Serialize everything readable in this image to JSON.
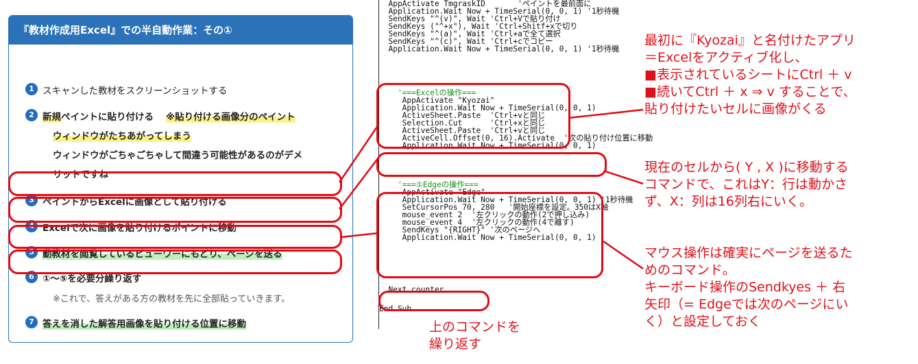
{
  "panel": {
    "title": "『教材作成用Excel』での半自動作業：その①",
    "steps": [
      {
        "num": "1",
        "text": "スキャンした教材をスクリーンショットする"
      },
      {
        "num": "2",
        "text_a": "新規",
        "text_b": "ペイントに貼り付ける",
        "text_c": "※貼り付ける画像分のペイント",
        "text_d": "ウィンドウがたちあがってしまう",
        "warn_1": "ウィンドウがごちゃごちゃして間違う可能性があるのがデメ",
        "warn_2": "リットですね"
      },
      {
        "num": "3",
        "text": "ペイントからExcelに画像として貼り付ける"
      },
      {
        "num": "4",
        "text": "Excelで次に画像を貼り付けるポイントに移動"
      },
      {
        "num": "5",
        "text": "動教材を閲覧しているビューワーにもどり、ページを送る"
      },
      {
        "num": "6",
        "text": "①～⑤を必要分繰り返す",
        "note": "※これで、答えがある方の教材を先に全部貼っていきます。"
      },
      {
        "num": "7",
        "text": "答えを消した解答用画像を貼り付ける位置に移動"
      }
    ]
  },
  "code_lines": [
    "  AppActivate TmgraskID       'ペイントを最前面に",
    "  Application.Wait Now + TimeSerial(0, 0, 1) '1秒待機",
    "  SendKeys \"^(v)\", Wait 'Ctrl+Vで貼り付け",
    "  SendKeys (\"^+x\"), Wait 'Ctrl+Shitf+xで切り",
    "  SendKeys \"^(a)\", Wait 'Ctrl+aで全て選択",
    "  SendKeys \"^(c)\", Wait 'Ctrl+cでコピー",
    "  Application.Wait Now + TimeSerial(0, 0, 1) '1秒待機",
    "",
    "    '===Excelの操作===",
    "     AppActivate \"Kyozai\"",
    "     Application.Wait Now + TimeSerial(0, 0, 1)",
    "     ActiveSheet.Paste  'Ctrl+vと同じ",
    "     Selection.Cut      'Ctrl+xと同じ",
    "     ActiveSheet.Paste  'Ctrl+vと同じ",
    "     ActiveCell.Offset(0, 16).Activate  '次の貼り付け位置に移動",
    "     Application.Wait Now + TimeSerial(0, 0, 1)",
    "",
    "",
    "    '===①Edgeの操作===",
    "     AppActivate \"Edge\"",
    "     Application.Wait Now + TimeSerial(0, 0, 1) '1秒待機",
    "     SetCursorPos 70, 280   '開始座標を設定。350はX軸",
    "     mouse_event 2  '左クリックの動作(2で押し込み)",
    "     mouse_event 4  '左クリックの動作(4で離す)",
    "     SendKeys \"{RIGHT}\" '次のページへ",
    "     Application.Wait Now + TimeSerial(0, 0, 1)",
    "",
    "",
    "  Next counter",
    "",
    "End Sub"
  ],
  "annotations": {
    "a1": [
      "最初に『Kyozai』と名付けたアプリ",
      "＝Excelをアクティブ化し、",
      "■表示されているシートにCtrl ＋ v",
      "■続いてCtrl ＋ x ⇒ v することで、",
      "貼り付けたいセルに画像がくる"
    ],
    "a2": [
      "現在のセルから( Y , X )に移動する",
      "コマンドで、これはY：行は動かさ",
      "ず、X：列は16列右にいく。"
    ],
    "a3": [
      "マウス操作は確実にページを送るた",
      "めのコマンド。",
      "キーボード操作のSendkyes ＋ 右",
      "矢印（= Edgeでは次のページにい",
      "く）と設定しておく"
    ],
    "a4": [
      "上のコマンドを",
      "繰り返す"
    ]
  },
  "colors": {
    "accent": "#2b72b8",
    "callout": "#e10a14",
    "code_comment": "#1a8c1a"
  }
}
